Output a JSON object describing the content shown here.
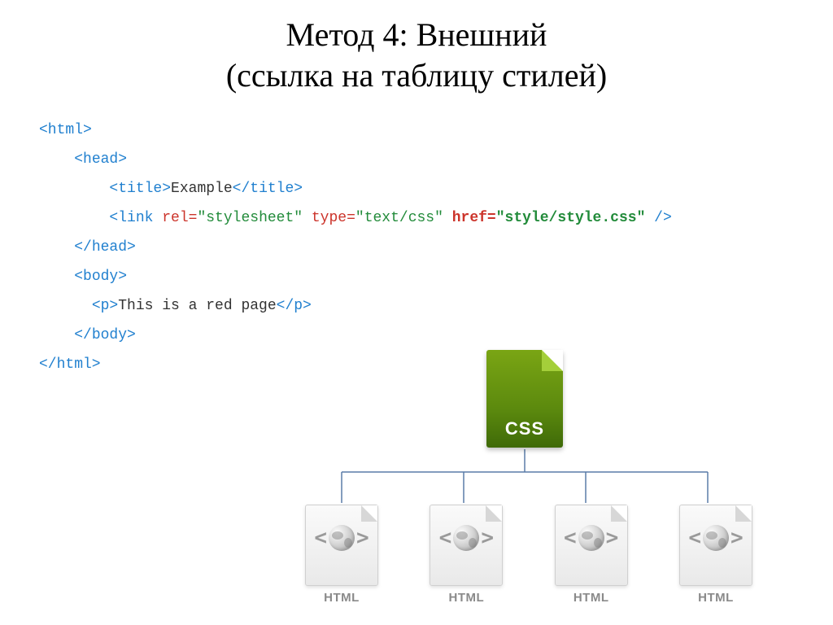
{
  "title": {
    "line1": "Метод 4: Внешний",
    "line2": "(ссылка на таблицу стилей)"
  },
  "code": {
    "l1_open": "<html>",
    "l2_open": "<head>",
    "l3_a": "<title>",
    "l3_txt": "Example",
    "l3_b": "</title>",
    "l4_tag": "<link ",
    "l4_attr1": "rel=",
    "l4_val1": "\"stylesheet\"",
    "l4_attr2": " type=",
    "l4_val2": "\"text/css\"",
    "l4_attr3": " href=",
    "l4_val3": "\"style/style.css\"",
    "l4_close": " />",
    "l5": "</head>",
    "l6": "<body>",
    "l7_a": "<p>",
    "l7_txt": "This is a red page",
    "l7_b": "</p>",
    "l8": "</body>",
    "l9": "</html>"
  },
  "diagram": {
    "css_label": "CSS",
    "html_label": "HTML"
  }
}
